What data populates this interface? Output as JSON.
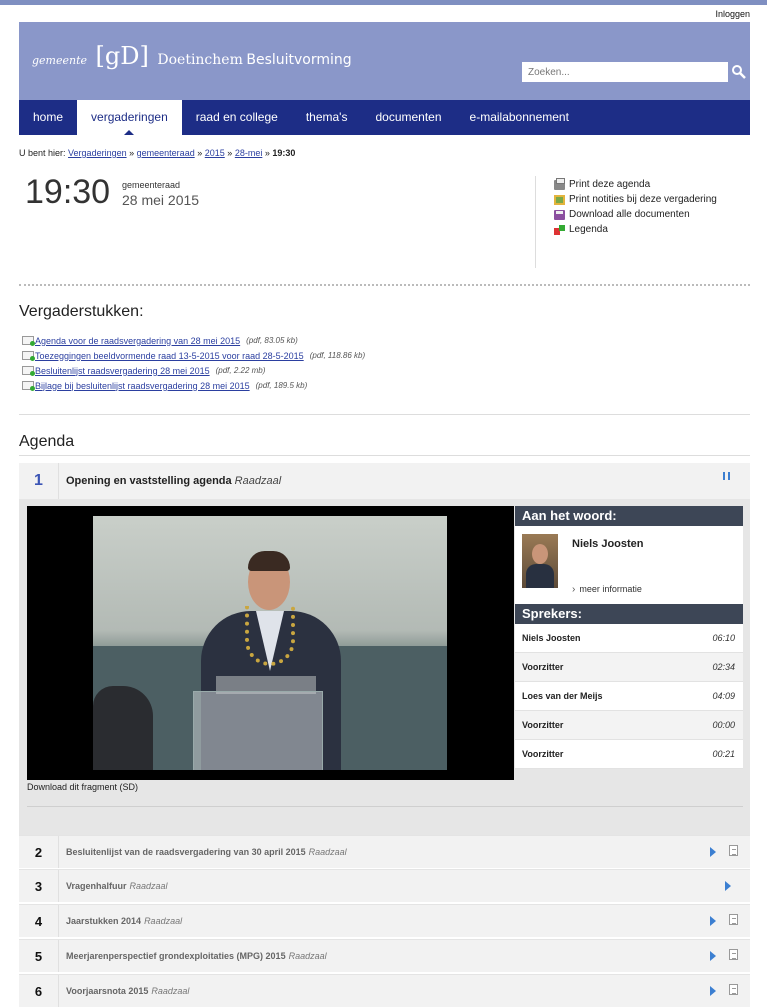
{
  "header": {
    "login": "Inloggen",
    "logo_prefix": "gemeente",
    "logo_mark": "[gD]",
    "logo_city": "Doetinchem",
    "logo_app": "Besluitvorming",
    "search_placeholder": "Zoeken..."
  },
  "nav": {
    "items": [
      "home",
      "vergaderingen",
      "raad en college",
      "thema's",
      "documenten",
      "e-mailabonnement"
    ],
    "active": "vergaderingen"
  },
  "breadcrumb": {
    "prefix": "U bent hier:",
    "items": [
      "Vergaderingen",
      "gemeenteraad",
      "2015",
      "28-mei"
    ],
    "separator": "»",
    "current": "19:30"
  },
  "meeting": {
    "time": "19:30",
    "type": "gemeenteraad",
    "date": "28 mei 2015"
  },
  "actions": [
    "Print deze agenda",
    "Print notities bij deze vergadering",
    "Download alle documenten",
    "Legenda"
  ],
  "documents": {
    "title": "Vergaderstukken:",
    "items": [
      {
        "name": "Agenda voor de raadsvergadering van 28 mei 2015",
        "meta": "(pdf, 83.05 kb)"
      },
      {
        "name": "Toezeggingen beeldvormende raad 13-5-2015 voor raad 28-5-2015",
        "meta": "(pdf, 118.86 kb)"
      },
      {
        "name": "Besluitenlijst raadsvergadering 28 mei 2015",
        "meta": "(pdf, 2.22 mb)"
      },
      {
        "name": "Bijlage bij besluitenlijst raadsvergadering 28 mei 2015",
        "meta": "(pdf, 189.5 kb)"
      }
    ]
  },
  "agenda": {
    "title": "Agenda",
    "items": [
      {
        "number": "1",
        "title": "Opening en vaststelling agenda",
        "location": "Raadzaal"
      },
      {
        "number": "2",
        "title": "Besluitenlijst van de raadsvergadering van 30 april 2015",
        "location": "Raadzaal"
      },
      {
        "number": "3",
        "title": "Vragenhalfuur",
        "location": "Raadzaal"
      },
      {
        "number": "4",
        "title": "Jaarstukken 2014",
        "location": "Raadzaal"
      },
      {
        "number": "5",
        "title": "Meerjarenperspectief grondexploitaties (MPG) 2015",
        "location": "Raadzaal"
      },
      {
        "number": "6",
        "title": "Voorjaarsnota 2015",
        "location": "Raadzaal"
      }
    ]
  },
  "video_panel": {
    "current_speaker_heading": "Aan het woord:",
    "current_speaker": "Niels Joosten",
    "more_info": "meer informatie",
    "speakers_heading": "Sprekers:",
    "speakers": [
      {
        "name": "Niels Joosten",
        "time": "06:10"
      },
      {
        "name": "Voorzitter",
        "time": "02:34"
      },
      {
        "name": "Loes van der Meijs",
        "time": "04:09"
      },
      {
        "name": "Voorzitter",
        "time": "00:00"
      },
      {
        "name": "Voorzitter",
        "time": "00:21"
      }
    ],
    "download_link": "Download dit fragment (SD)"
  },
  "colors": {
    "header_bg": "#8a97c9",
    "nav_bg": "#1d2d86",
    "link": "#2b3fa0",
    "panel_heading": "#3d4656",
    "play_icon": "#3c7fd1"
  }
}
